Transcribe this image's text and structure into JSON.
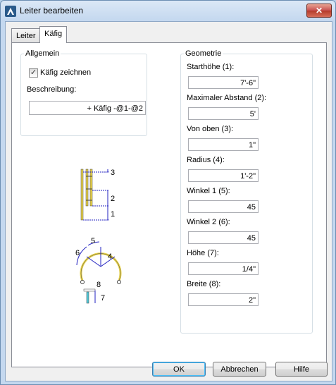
{
  "window": {
    "title": "Leiter bearbeiten",
    "close_glyph": "✕",
    "icon": "autocad-a-icon"
  },
  "tabs": [
    {
      "label": "Leiter",
      "active": false
    },
    {
      "label": "Käfig",
      "active": true
    }
  ],
  "allgemein": {
    "group_label": "Allgemein",
    "checkbox_label": "Käfig zeichnen",
    "checkbox_checked": true,
    "description_label": "Beschreibung:",
    "description_value": "+ Käfig -@1-@2"
  },
  "geometrie": {
    "group_label": "Geometrie",
    "fields": [
      {
        "label": "Starthöhe (1):",
        "value": "7'-6\""
      },
      {
        "label": "Maximaler Abstand (2):",
        "value": "5'"
      },
      {
        "label": "Von oben (3):",
        "value": "1\""
      },
      {
        "label": "Radius (4):",
        "value": "1'-2\""
      },
      {
        "label": "Winkel 1 (5):",
        "value": "45"
      },
      {
        "label": "Winkel 2 (6):",
        "value": "45"
      },
      {
        "label": "Höhe (7):",
        "value": "1/4\""
      },
      {
        "label": "Breite (8):",
        "value": "2\""
      }
    ]
  },
  "diagram_labels": {
    "side": [
      "3",
      "2",
      "1"
    ],
    "top": [
      "5",
      "6",
      "4",
      "8",
      "7"
    ]
  },
  "buttons": {
    "ok": "OK",
    "cancel": "Abbrechen",
    "help": "Hilfe"
  },
  "colors": {
    "ladder_rail": "#e8d24a",
    "dimension": "#2020c0",
    "accent": "#3c7fb1"
  }
}
